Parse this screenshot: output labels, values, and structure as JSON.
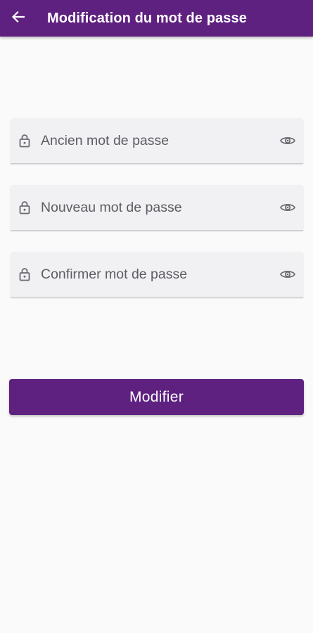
{
  "app_bar": {
    "title": "Modification du mot de passe",
    "back_icon": "arrow-left-icon",
    "color": "#5e2180"
  },
  "form": {
    "fields": [
      {
        "placeholder": "Ancien mot de passe",
        "leading_icon": "lock-icon",
        "trailing_icon": "eye-icon"
      },
      {
        "placeholder": "Nouveau mot de passe",
        "leading_icon": "lock-icon",
        "trailing_icon": "eye-icon"
      },
      {
        "placeholder": "Confirmer mot de passe",
        "leading_icon": "lock-icon",
        "trailing_icon": "eye-icon"
      }
    ],
    "submit_label": "Modifier",
    "accent_color": "#5e2180"
  }
}
